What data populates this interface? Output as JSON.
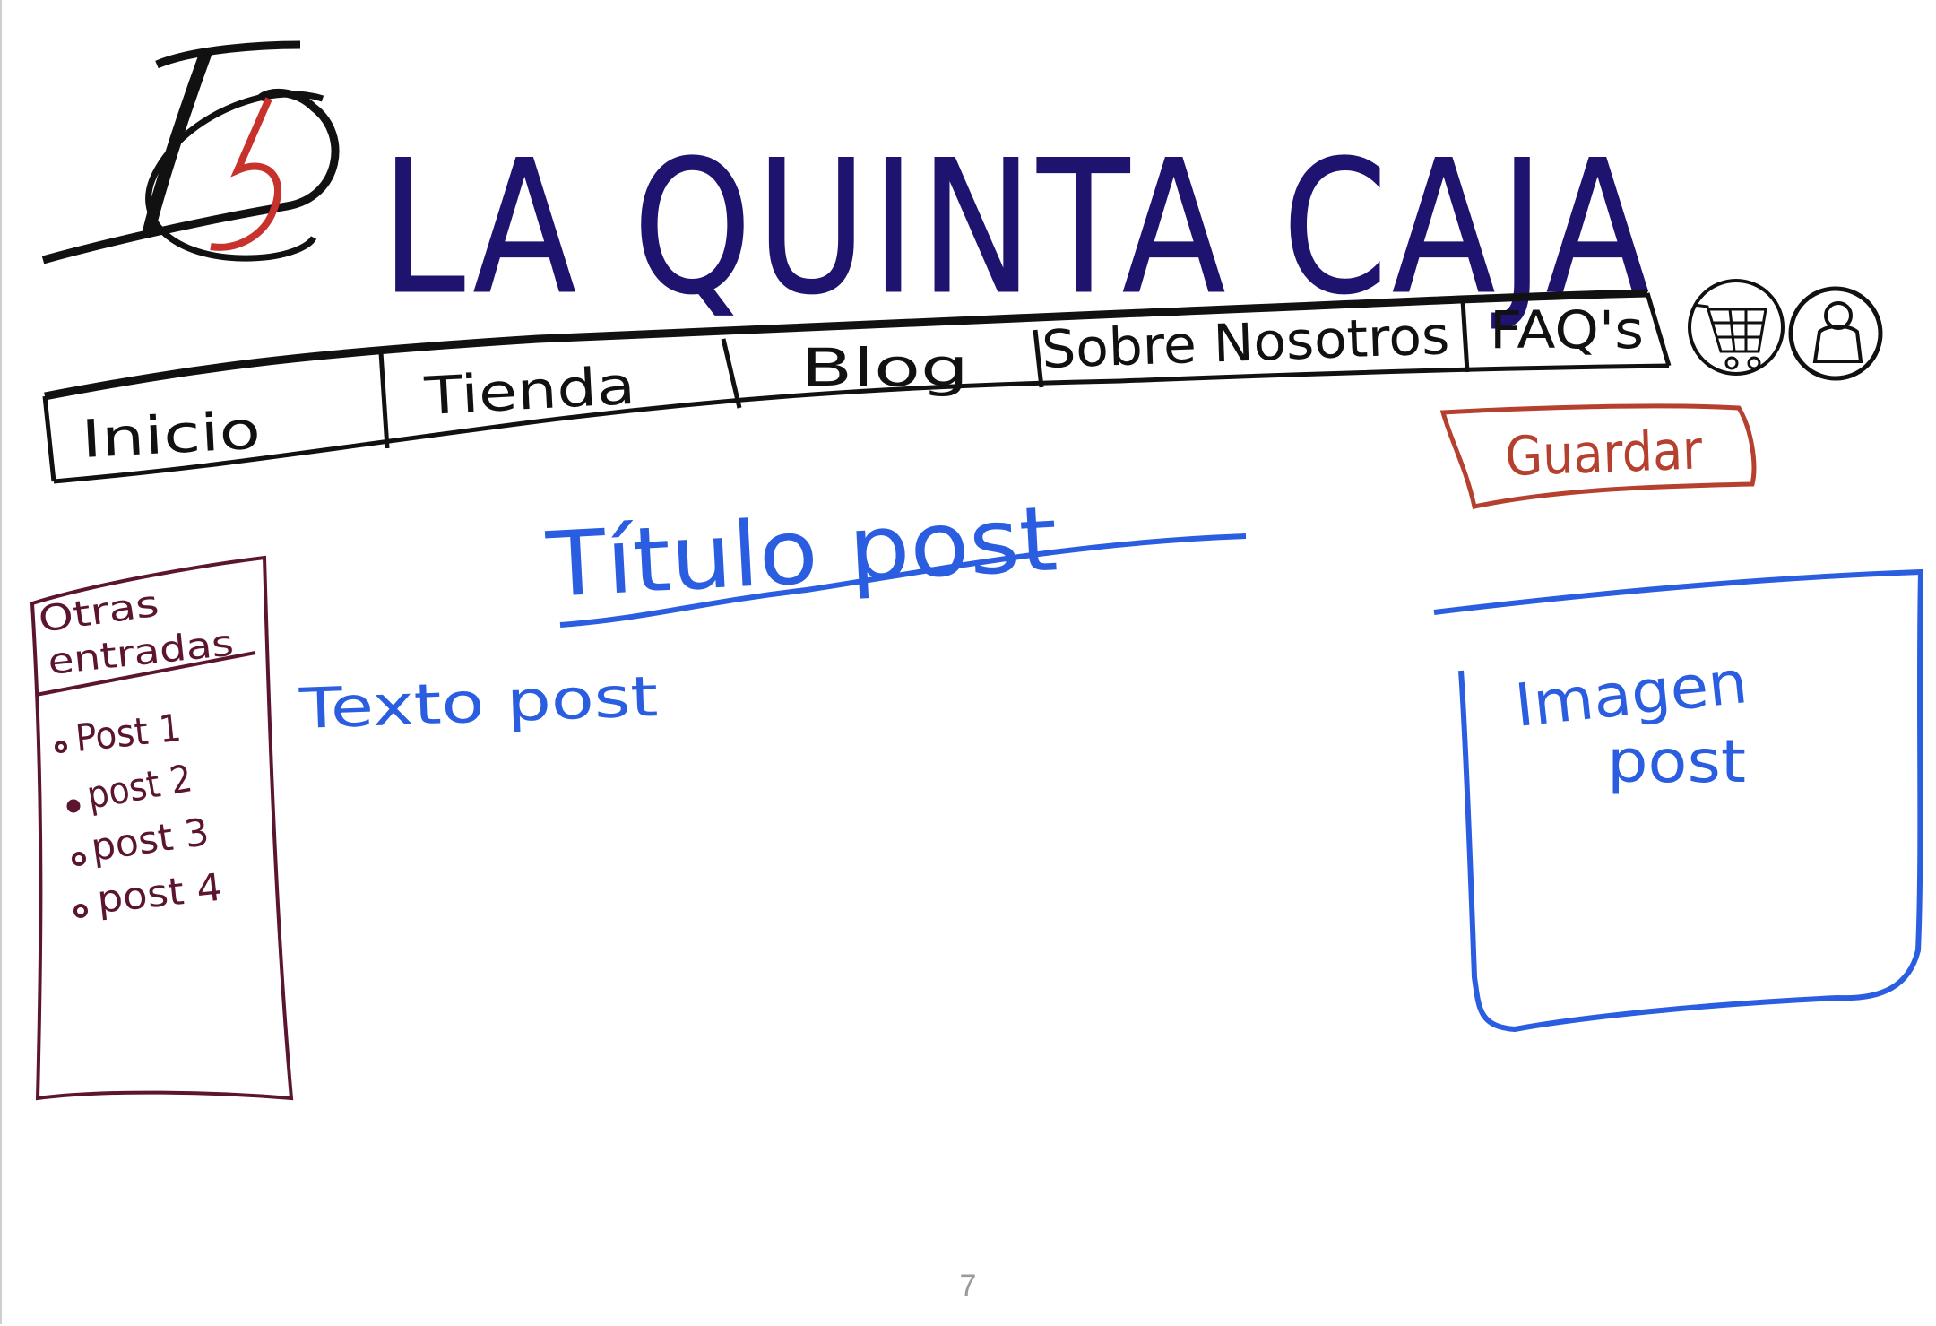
{
  "brand": {
    "logo_text": "JC5",
    "site_title": "LA QUINTA CAJA"
  },
  "nav": {
    "items": [
      {
        "label": "Inicio"
      },
      {
        "label": "Tienda"
      },
      {
        "label": "Blog"
      },
      {
        "label": "Sobre Nosotros"
      },
      {
        "label": "FAQ's"
      }
    ],
    "cart_icon": "shopping-cart-icon",
    "user_icon": "user-icon"
  },
  "actions": {
    "save_label": "Guardar"
  },
  "post": {
    "title": "Título post",
    "text": "Texto post",
    "image_label_line1": "Imagen",
    "image_label_line2": "post"
  },
  "sidebar": {
    "title_line1": "Otras",
    "title_line2": "entradas",
    "items": [
      {
        "label": "Post 1"
      },
      {
        "label": "post 2"
      },
      {
        "label": "post 3"
      },
      {
        "label": "post 4"
      }
    ]
  },
  "page_number": "7",
  "colors": {
    "ink_black": "#111111",
    "title_navy": "#1e1470",
    "save_red": "#b5402e",
    "blue": "#2a5de0",
    "sidebar_maroon": "#5c1530",
    "logo_red": "#c8322c"
  }
}
